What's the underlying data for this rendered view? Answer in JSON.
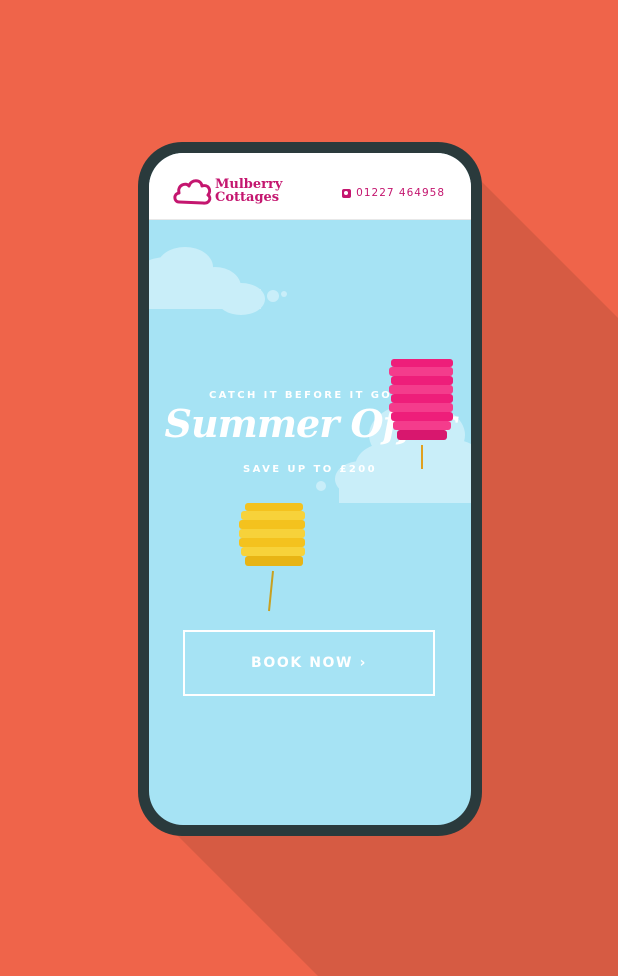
{
  "brand": {
    "name_line1": "Mulberry",
    "name_line2": "Cottages",
    "icon": "cloud-logo-icon",
    "color": "#c4166f"
  },
  "contact": {
    "icon": "phone-icon",
    "phone": "01227 464958"
  },
  "hero": {
    "eyebrow": "CATCH IT BEFORE IT GOES",
    "headline": "Summer Offer",
    "subhead": "SAVE UP TO £200",
    "cta_label": "BOOK NOW ›",
    "background_color": "#a6e3f4",
    "cloud_color": "#c9eef9",
    "lantern_colors": [
      "#ee1e7a",
      "#f4c21e"
    ]
  },
  "page": {
    "background_color": "#ef644a",
    "device_frame_color": "#2a3a3c"
  }
}
